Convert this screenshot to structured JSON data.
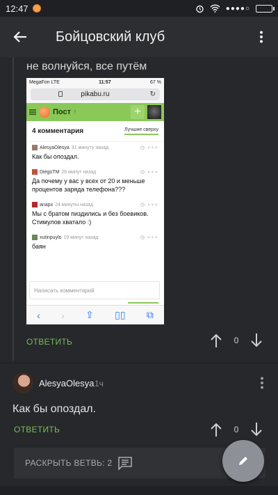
{
  "status_bar": {
    "time": "12:47",
    "signal": "●●●●○"
  },
  "app_bar": {
    "title": "Бойцовский клуб"
  },
  "comment1": {
    "text": "не волнуйся, все путём",
    "reply_label": "ОТВЕТИТЬ",
    "score": "0"
  },
  "screenshot": {
    "carrier": "MegaFon  LTE",
    "time": "11:57",
    "battery": "67 %",
    "url": "pikabu.ru",
    "nav_title": "Пост",
    "comment_count": "4 комментария",
    "sort_label": "Лучшие сверху",
    "comments": [
      {
        "user": "AlesyaOlesya",
        "time": "31 минуту назад",
        "text": "Как бы опоздал."
      },
      {
        "user": "DiegoTM",
        "time": "26 минут назад",
        "text": "Да почему у вас у всех от 20 и меньше процентов заряда телефона???"
      },
      {
        "user": "anapx",
        "time": "24 минуты назад",
        "text": "Мы с братом пиздились и без боевиков. Стимулов хватало :)"
      },
      {
        "user": "xutinpuylo",
        "time": "19 минут назад",
        "text": "баян"
      }
    ],
    "input_placeholder": "Написать комментарий"
  },
  "comment2": {
    "user": "AlesyaOlesya",
    "time": "1ч",
    "text": "Как бы опоздал.",
    "reply_label": "ОТВЕТИТЬ",
    "score": "0"
  },
  "expand_branch": {
    "label": "РАСКРЫТЬ ВЕТВЬ: 2"
  },
  "colors": {
    "accent_green": "#7cbb57",
    "background": "#26282b",
    "pikabu_green": "#8ac858"
  },
  "icons": [
    "back-arrow-icon",
    "more-vert-icon",
    "upvote-icon",
    "downvote-icon",
    "comment-icon",
    "pencil-icon"
  ]
}
